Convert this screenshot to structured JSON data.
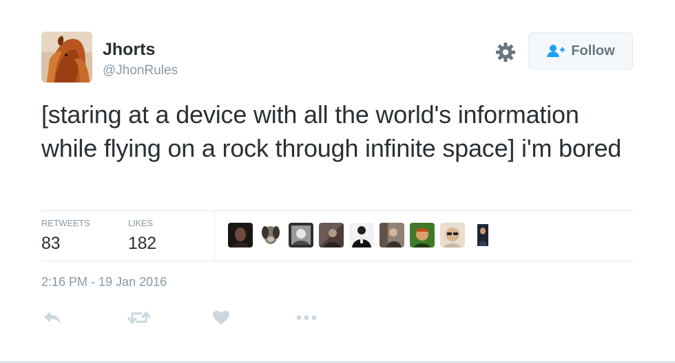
{
  "user": {
    "name": "Jhorts",
    "handle": "@JhonRules",
    "avatar_icon": "horse-avatar"
  },
  "header": {
    "settings_icon": "gear-icon",
    "follow_label": "Follow",
    "follow_icon": "add-user-icon"
  },
  "tweet": {
    "text": "[staring at a device with all the world's information while flying on a rock through infinite space] i'm bored"
  },
  "stats": {
    "retweets_label": "RETWEETS",
    "retweets_count": "83",
    "likes_label": "LIKES",
    "likes_count": "182",
    "liker_avatars": 9
  },
  "meta": {
    "timestamp": "2:16 PM - 19 Jan 2016"
  },
  "actions": {
    "icons": [
      "reply-icon",
      "retweet-icon",
      "like-icon",
      "more-icon"
    ]
  },
  "colors": {
    "text": "#292f33",
    "muted": "#8899a6",
    "action": "#ccd6dd",
    "border": "#e1e8ed",
    "follow_icon": "#1da1f2"
  }
}
